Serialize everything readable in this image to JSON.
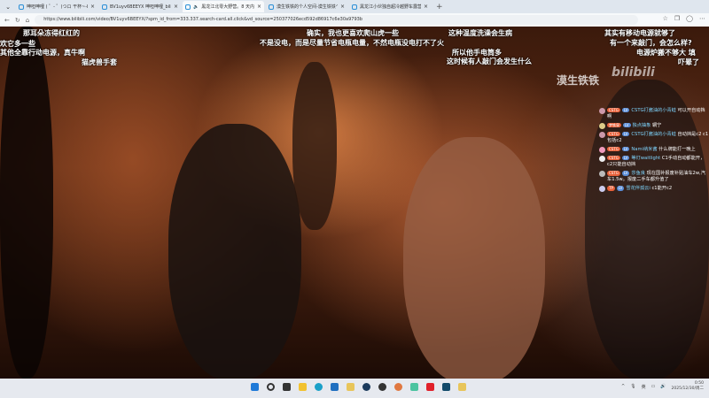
{
  "browser": {
    "tabs": [
      {
        "title": "呻呾呻哩 ( ゜- ゜)つロ 干杯~-bilibili"
      },
      {
        "title": "BV1uyv6BEEYX 呻呾呻哩_bilibili"
      },
      {
        "title": "黑龙江北零大野营。8 天内零下...",
        "active": true
      },
      {
        "title": "漠生铁铁的个人空间-漠生铁铁个人..."
      },
      {
        "title": "黑龙江小伙独自超冷越野车露营..."
      }
    ],
    "url": "https://www.bilibili.com/video/BV1uyv6BEEYX/?spm_id_from=333.337.search-card.all.click&vd_source=250377026ecd592d86917c6e30a9793b"
  },
  "danmaku": [
    "那耳朵冻得红红的",
    "欢它多一些",
    "其他全靠行动电源，真牛啊",
    "猫虎兽手套",
    "确实，我也更喜欢爬山虎一些",
    "不是没电，而是尽量节省电瓶电量，不然电瓶没电打不了火",
    "这种温度洗澡会生病",
    "所以他手电筒多",
    "这时候有人敲门会发生什么",
    "其实有移动电源就够了",
    "有一个来敲门，会怎么样?",
    "电源炉搬不够大 填",
    "吓晕了"
  ],
  "watermark": {
    "uploader": "漠生铁铁",
    "site": "bilibili"
  },
  "chat": [
    {
      "badge": "CSTG",
      "level": "LV",
      "name": "CSTG打酱油的小青蛙",
      "text": "可以开自动挡啊"
    },
    {
      "badge": "梦铁泉",
      "level": "LV",
      "name": "独点抽象",
      "text": "辋宁"
    },
    {
      "badge": "CSTG",
      "level": "LV",
      "name": "CSTG打酱油的小青蛙",
      "text": "自动挡是c2 c1包括c2"
    },
    {
      "badge": "CSTG",
      "level": "LV",
      "name": "Nami纳米酱",
      "text": "什么牌能打一晚上"
    },
    {
      "badge": "CSTG",
      "level": "LV",
      "name": "等灯waitlight",
      "text": "C1手动自动都能开，c2只能自动挡"
    },
    {
      "badge": "CSTG",
      "level": "LV",
      "name": "莎鱼良",
      "text": "现在国补报废补贴油车2w,汽车1.5w。报废二手车都升值了"
    },
    {
      "badge": "TP",
      "level": "LV",
      "name": "雪花伴孤云i",
      "text": "c1能开c2"
    }
  ],
  "taskbar": {
    "time": "0:50",
    "date": "2025/12/30/周二"
  }
}
